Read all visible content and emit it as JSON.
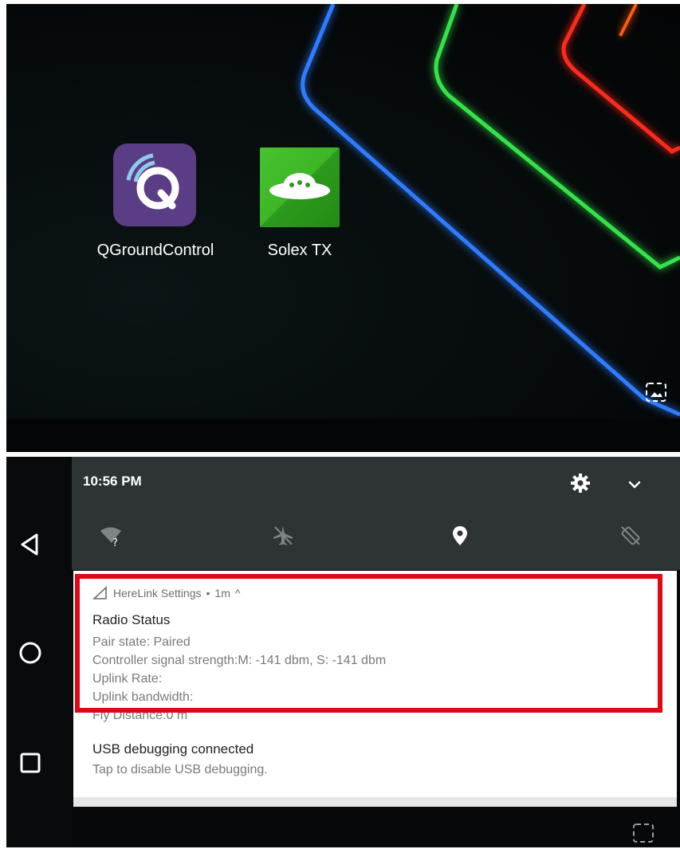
{
  "home": {
    "apps": [
      {
        "label": "QGroundControl",
        "icon": "qgroundcontrol-icon"
      },
      {
        "label": "Solex TX",
        "icon": "solex-ufo-icon"
      }
    ],
    "corner_icon": "screenshot-icon"
  },
  "shade": {
    "time": "10:56 PM",
    "icons": [
      "settings-gear-icon",
      "chevron-down-icon"
    ],
    "quick_settings": [
      "wifi-unknown-icon",
      "airplane-mode-icon",
      "location-icon",
      "auto-rotate-icon"
    ]
  },
  "notifications": [
    {
      "app": "HereLink Settings",
      "separator": "•",
      "age": "1m",
      "expanded_glyph": "^",
      "title": "Radio Status",
      "lines": [
        "Pair state: Paired",
        "Controller signal strength:M: -141 dbm, S: -141 dbm",
        "Uplink Rate:",
        "Uplink bandwidth:",
        "Fly Distance:0 m"
      ]
    },
    {
      "title": "USB debugging connected",
      "text": "Tap to disable USB debugging."
    }
  ],
  "navigation": [
    "back-icon",
    "home-icon",
    "recents-icon"
  ],
  "colors": {
    "highlight": "#e30613",
    "qgc_icon_bg": "#5b3d86",
    "solex_icon_bg": "#3db626",
    "shade_bg": "#2e3335"
  }
}
